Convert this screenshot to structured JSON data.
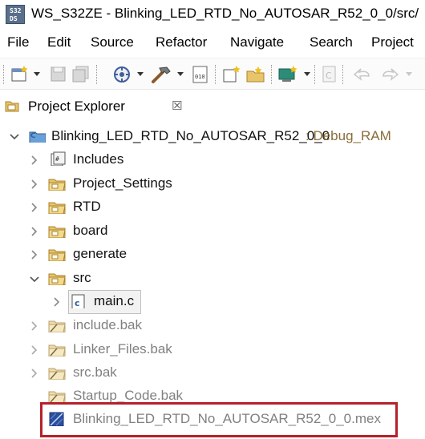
{
  "window": {
    "title": "WS_S32ZE - Blinking_LED_RTD_No_AUTOSAR_R52_0_0/src/",
    "app_icon_text_top": "S32",
    "app_icon_text_bottom": "DS"
  },
  "menu": [
    "File",
    "Edit",
    "Source",
    "Refactor",
    "Navigate",
    "Search",
    "Project"
  ],
  "view": {
    "title": "Project Explorer",
    "close_glyph": "☒"
  },
  "tree": {
    "project": {
      "name": "Blinking_LED_RTD_No_AUTOSAR_R52_0_0",
      "config": ": Debug_RAM"
    },
    "children": [
      {
        "label": "Includes",
        "icon": "includes-icon"
      },
      {
        "label": "Project_Settings",
        "icon": "folder-icon"
      },
      {
        "label": "RTD",
        "icon": "folder-icon"
      },
      {
        "label": "board",
        "icon": "folder-icon"
      },
      {
        "label": "generate",
        "icon": "folder-icon"
      },
      {
        "label": "src",
        "icon": "folder-icon"
      },
      {
        "label": "main.c",
        "icon": "c-file-icon"
      },
      {
        "label": "include.bak",
        "icon": "excluded-folder-icon"
      },
      {
        "label": "Linker_Files.bak",
        "icon": "excluded-folder-icon"
      },
      {
        "label": "src.bak",
        "icon": "excluded-folder-icon"
      },
      {
        "label": "Startup_Code.bak",
        "icon": "excluded-folder-icon"
      },
      {
        "label": "Blinking_LED_RTD_No_AUTOSAR_R52_0_0.mex",
        "icon": "mex-file-icon"
      }
    ]
  },
  "colors": {
    "highlight": "#b5212a",
    "folder": "#e8c46a",
    "dim_text": "#808080"
  }
}
